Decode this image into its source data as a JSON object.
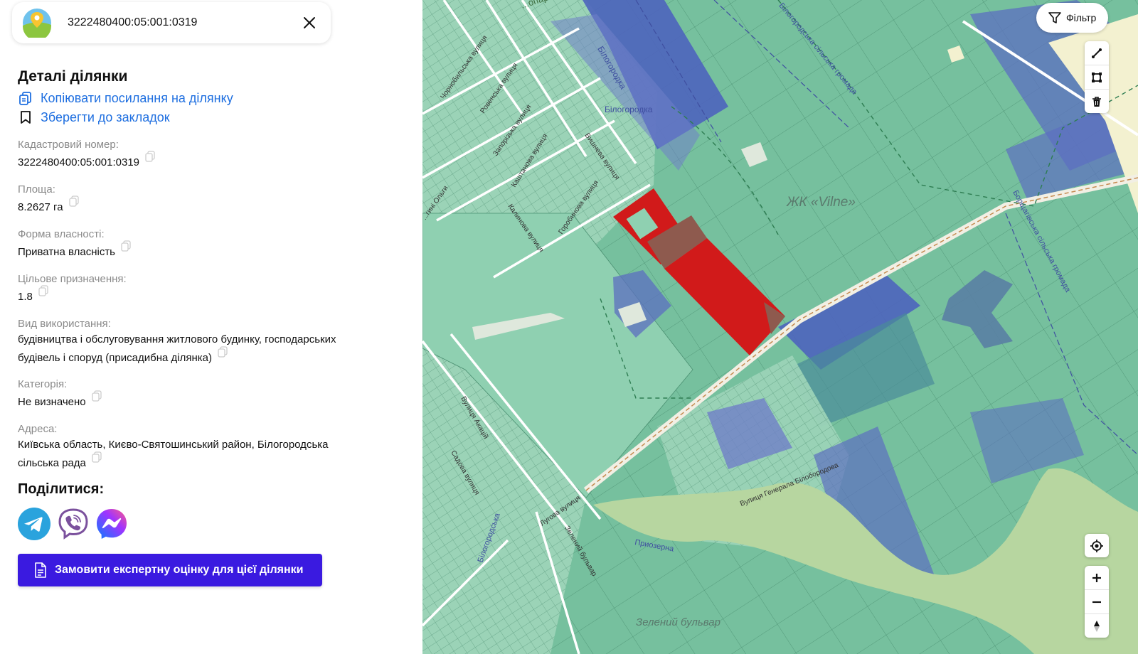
{
  "search": {
    "value": "3222480400:05:001:0319"
  },
  "details": {
    "title": "Деталі ділянки",
    "copy_link": "Копіювати посилання на ділянку",
    "save_bookmark": "Зберегти до закладок",
    "fields": [
      {
        "label": "Кадастровий номер:",
        "value": "3222480400:05:001:0319"
      },
      {
        "label": "Площа:",
        "value": "8.2627 га"
      },
      {
        "label": "Форма власності:",
        "value": "Приватна власність"
      },
      {
        "label": "Цільове призначення:",
        "value": "1.8"
      },
      {
        "label": "Вид використання:",
        "value_line1": "будівництва і обслуговування житлового будинку, господарських",
        "value_line2": "будівель і споруд (присадибна ділянка)"
      },
      {
        "label": "Категорія:",
        "value": "Не визначено"
      },
      {
        "label": "Адреса:",
        "value_line1": "Київська область, Києво-Святошинський район, Білогородська",
        "value_line2": "сільська рада"
      }
    ]
  },
  "share": {
    "title": "Поділитися:",
    "services": [
      "telegram",
      "viber",
      "messenger"
    ]
  },
  "order_button": "Замовити експертну оцінку для цієї ділянки",
  "map": {
    "filter_label": "Фільтр",
    "labels": {
      "park": "...опарк",
      "belogorodka1": "Білогородка",
      "belogorodka2": "Білогородка",
      "zhk": "ЖК «Vilne»",
      "chornobylska": "Чорнобильська вулиця",
      "rovenska": "Ровенська вулиця",
      "zaporizka": "Запорізька вулиця",
      "kashtanova": "Каштанова вулиця",
      "vyshneva": "Вишнева вулиця",
      "horobynova": "Горобинова вулиця",
      "kalynova": "Калинова вулиця",
      "olgy": "...гині Ольги",
      "silska": "Білогородська сільська громада",
      "borshch": "Борщагівська сільська громада",
      "lugova": "Лугова вулиця",
      "zelenyi": "Зелений бульвар",
      "pryozerna": "Приозерна",
      "zelenyi_big": "Зелений бульвар",
      "akatsiy": "Вулиця Акацій",
      "sadova": "Садова вулиця",
      "bilogorodska_left": "Білогородська",
      "mastera": "Вулиця Генерала Білобородова"
    },
    "colors": {
      "base_green": "#7ec3a4",
      "light_green": "#a7d9bd",
      "dark_green": "#4faa83",
      "blue": "#5c6fc0",
      "red": "#d11a1a",
      "brown": "#8e5a4e",
      "park_green": "#b7d6a0",
      "yellow": "#f3f1d0"
    }
  },
  "ui_colors": {
    "accent": "#1f6fe0",
    "button": "#3a1ae0"
  }
}
